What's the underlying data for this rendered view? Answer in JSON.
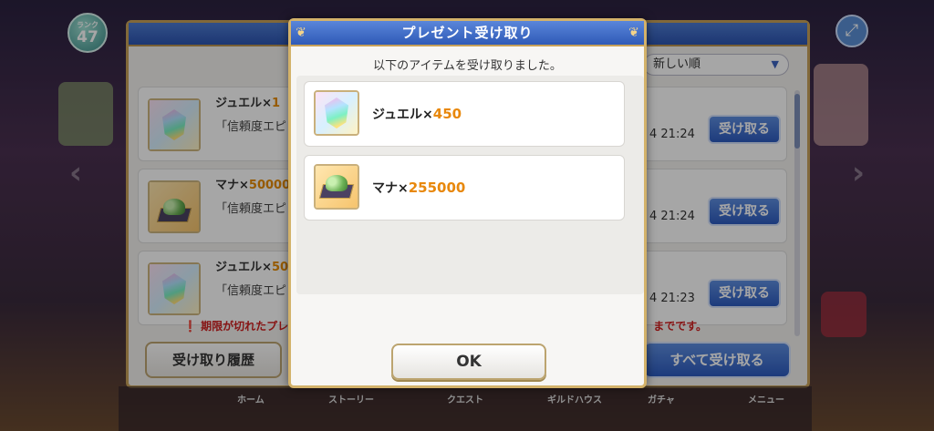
{
  "background": {
    "level": {
      "lv_label": "ランク",
      "value": "47"
    },
    "sort": {
      "selected": "新しい順"
    },
    "items": [
      {
        "name": "ジュエル×",
        "amount": "1",
        "desc": "「信頼度エピ",
        "time": "4 21:24",
        "button": "受け取る",
        "icon": "jewel-icon"
      },
      {
        "name": "マナ×",
        "amount": "50000",
        "desc": "「信頼度エピ",
        "time": "4 21:24",
        "button": "受け取る",
        "icon": "mana-icon"
      },
      {
        "name": "ジュエル×",
        "amount": "50",
        "desc": "「信頼度エピ",
        "time": "4 21:23",
        "button": "受け取る",
        "icon": "jewel-icon"
      }
    ],
    "expire_note_left": "期限が切れたプレ",
    "expire_note_right": "までです。",
    "history_button": "受け取り履歴",
    "receive_all_button": "すべて受け取る",
    "nav": [
      "ホーム",
      "ストーリー",
      "クエスト",
      "ギルドハウス",
      "ガチャ",
      "メニュー"
    ]
  },
  "dialog": {
    "title": "プレゼント受け取り",
    "message": "以下のアイテムを受け取りました。",
    "items": [
      {
        "name": "ジュエル×",
        "amount": "450",
        "icon": "jewel-icon"
      },
      {
        "name": "マナ×",
        "amount": "255000",
        "icon": "mana-icon"
      }
    ],
    "ok_button": "OK"
  },
  "colors": {
    "accent_blue": "#2f5ab7",
    "gold_border": "#d3b26a",
    "amount_orange": "#e8880c"
  }
}
